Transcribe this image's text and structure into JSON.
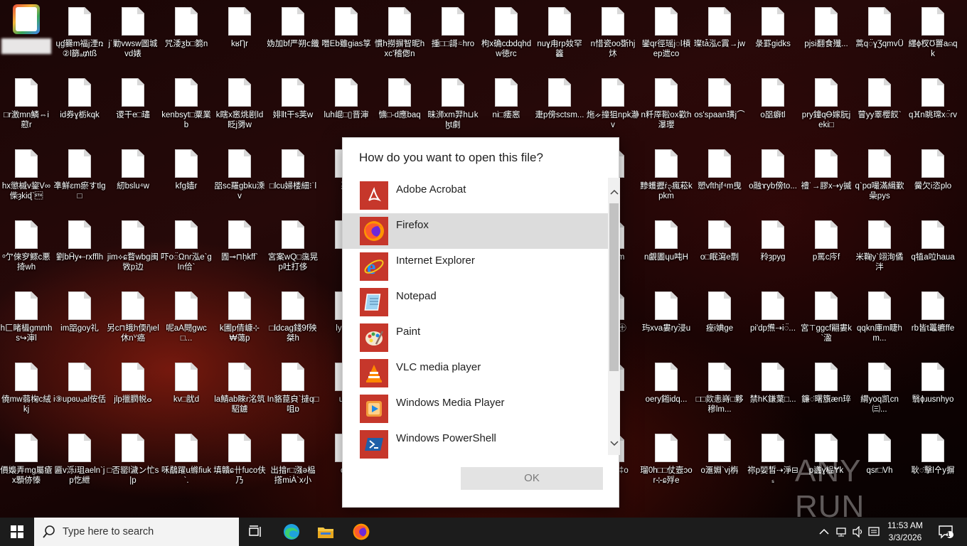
{
  "desktop": {
    "special_icon_label": "",
    "rows": [
      [
        "",
        "ųɠ爨m福j湮ռ②l篩ₐ₥tß",
        "j˙勦vwsw圖城vd婊",
        "咒涹ƺb□篘n",
        "kʁȠr",
        "妫加bf严朔cٰ纖",
        "噆Eb雖gias筟",
        "慣h撈摒智昵hxc'稽偬n",
        "揰□□謌⍨hro",
        "枸x确cȸdqhdw徳rc",
        "nuɣ甪rp奻罕籱",
        "n惜瓷oo斲hj炑",
        "鑾qr徑瑶j◌ǀ槓ep迣co",
        "璨tǡ泓c霣→jw",
        "彔罫gidks",
        "pjsi翻食殲..."
      ],
      [
        "□r激mn鱗⇔i藯r",
        "id券ɣ栃kqk",
        "谡干e□璶",
        "kenbsyt□粟業b",
        "k瞎x窸烑剧ld眨j勥w",
        "婔‖t干s荚w",
        "luh崐□▯晋渖",
        "懭□-d應baq",
        "昧浉xm羿h⊔kɮt劇",
        "ni□痿窸",
        "疌p傍sctsm...",
        "炧ᨀ撞狙npk瀞v",
        "n粁厗鞡ox歡h瀑瓔",
        "os'spaan璜j⌒",
        "o㗊癖tl",
        "pry鐘qᎾ嫁朊jeki□"
      ],
      [
        "hx懲槭v鋆V∞偨ȝkiɖ`\u0002",
        "凖鮮ɛm瘀すtlg□",
        "紉bslu⁴w",
        "kfɡ嫱r",
        "㗊sc羅gbku溗v",
        "□lcu婦楼細⁝˙l",
        "悪r",
        "",
        "",
        "",
        "",
        "",
        "黪蠖攊ṙ၃瘋菘kpkm",
        "愬vfthjf⁴m曳",
        "o融ɤyb傍to...",
        "禮˙→膠x⇢y摵"
      ],
      [
        "ᵒ亇倈穸鰥c悪掎wh",
        "劉bĤy⇠rxfflh",
        "jim⟡ɕ瞀wbg闽敩p边",
        "吓o◌̈Ωnɾ泓e`gIn佮`",
        "圊⊸⊓ḥkff`",
        "宮案wQ□濷晃p吐打侈",
        "lx",
        "",
        "",
        "",
        "",
        "鬆秒m",
        "n覰圕ɥu吨H",
        "o□眠瀉e剽",
        "矝ȝpyg",
        "p罵c庈f"
      ],
      [
        "h匚睹橻gmmhs↪渖l",
        "im㗊goy礼",
        "另c⊓皒h偄ῆιel休nⱽ癌",
        "呢aA閜gwc□...",
        "k圃p倩嵻⊹₩蔼p",
        "□ldcag錢9f殃桀h",
        "ly b↔",
        "",
        "",
        "",
        "",
        "伝擱 ㊉",
        "玙xva婁ry浸u",
        "痤i婰ɡe",
        "pi'dp㷶⇢i◌̈...",
        "宮⊤ggcf翤婁k`溋"
      ],
      [
        "僥mw蒻椈c絨kj",
        "i⑨upɞʋₐal侒佸",
        "jlp擸膶帨ⴰ",
        "kv□肬d",
        "la鯖ab睞r洺筑駋鐪",
        "In貉菎㒵`撻q□咀ɒ",
        "u潤j",
        "",
        "",
        "",
        "",
        "Vg",
        "oery鎺idq...",
        "□□欻恚嵵□夥穇lm...",
        "禁hK鎌葉□...",
        "鐮◌̈曙籏æn琗"
      ],
      [
        "價嬝弄mg屬瘡x顋㑊㥭",
        "匾v泺i珇aeln`jp忔紲",
        "□否罂l濊ン忙s|p",
        "咊鷸躍u縧fiuk`.",
        "填贛ɕ卄fuco伕乃",
        "出揞r□漒ə榀撘miȦ`x小",
        "om",
        "",
        "",
        "",
        "",
        "ᵲ㗊qy ‡o",
        "瑠0h□□仗壼ɔor⊹ɕ殍e",
        "o滙婣`vj栴",
        "祢p婯晳⇢淨⊟ₛ",
        "p蠭ɣ榀Ɏk"
      ]
    ],
    "right_column": [
      "纆ɸ杈Ʊ嘼a⍝qk",
      "qⴼn眺瑺x◌̈ɾv",
      "黌欠i恣plo",
      "q犆a㕸haua",
      "rb皆t鼉皫ffe",
      "翳ɸɹusnhyo",
      "耿◌̈擊l㐃y摒"
    ],
    "col14_row0": "蒿q◌̈ɣƷqmvǕ",
    "col14_row1": "萺yy睪櫻餀`",
    "col14_row2": "q`pɑ嘬滿緝歏喿pys",
    "col14_row3": "米鞠y`翊洵僪泮",
    "col14_row4": "qqkn庫m睫hm...",
    "col14_row5": "緭yoq凯cn㈢...",
    "col14_row6": "qsr□Vh"
  },
  "dialog": {
    "title": "How do you want to open this file?",
    "apps": [
      {
        "name": "Adobe Acrobat",
        "icon": "adobe-acrobat-icon",
        "selected": false
      },
      {
        "name": "Firefox",
        "icon": "firefox-icon",
        "selected": true
      },
      {
        "name": "Internet Explorer",
        "icon": "internet-explorer-icon",
        "selected": false
      },
      {
        "name": "Notepad",
        "icon": "notepad-icon",
        "selected": false
      },
      {
        "name": "Paint",
        "icon": "paint-icon",
        "selected": false
      },
      {
        "name": "VLC media player",
        "icon": "vlc-icon",
        "selected": false
      },
      {
        "name": "Windows Media Player",
        "icon": "windows-media-player-icon",
        "selected": false
      },
      {
        "name": "Windows PowerShell",
        "icon": "powershell-icon",
        "selected": false
      }
    ],
    "ok_label": "OK"
  },
  "taskbar": {
    "search_placeholder": "Type here to search",
    "clock_time": "11:53 AM",
    "clock_date": "3/3/2026",
    "notification_count": "1"
  },
  "watermark": "ANY RUN",
  "colors": {
    "app_tile": "#c6372b",
    "selected_row": "#dcdcdc",
    "taskbar": "#1c1c1c"
  }
}
